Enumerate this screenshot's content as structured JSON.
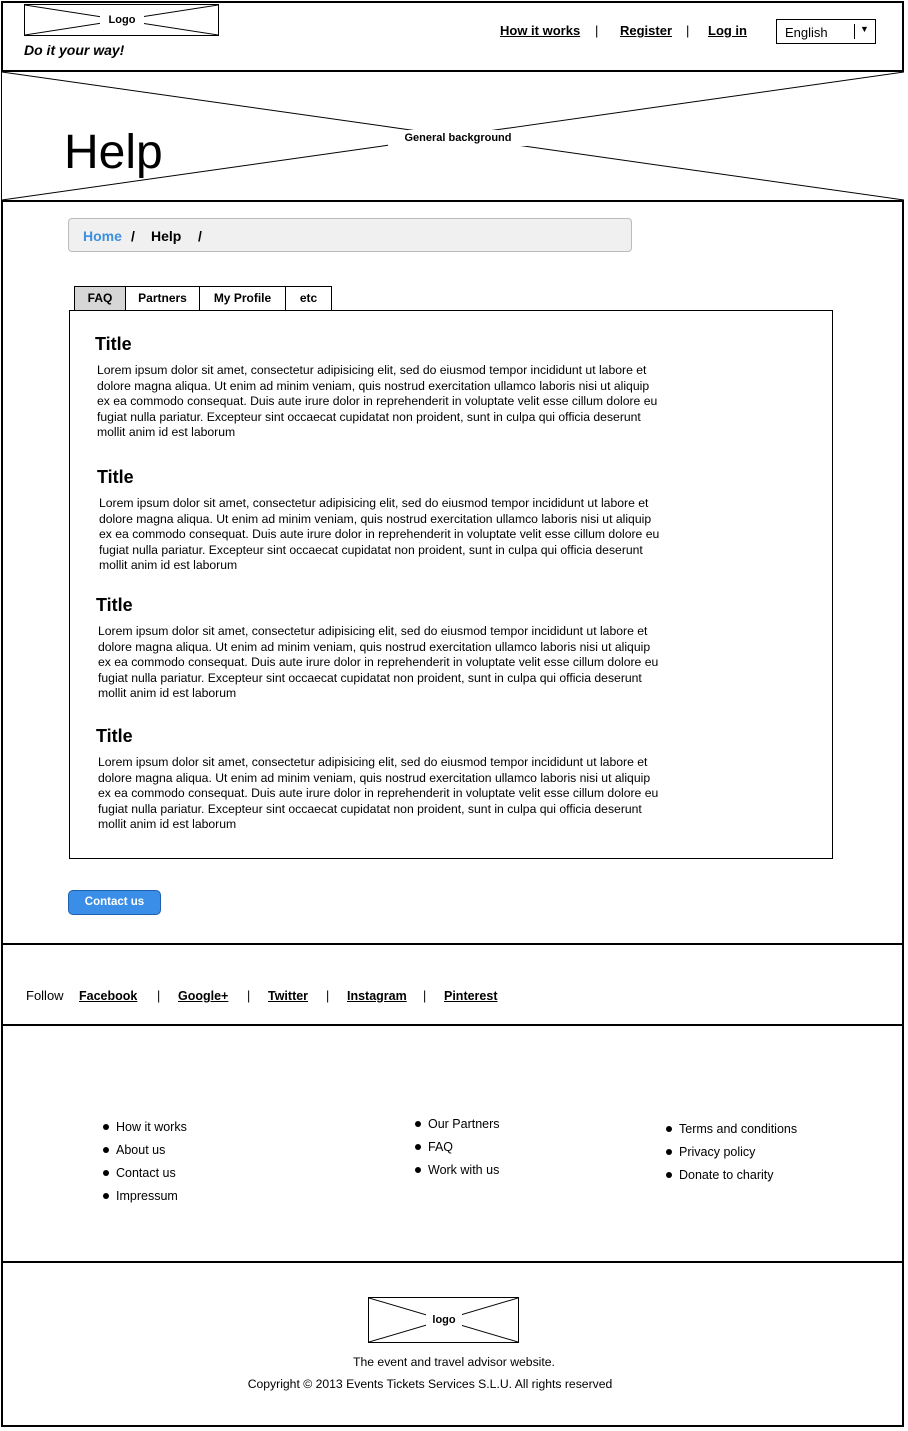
{
  "header": {
    "logo_label": "Logo",
    "tagline": "Do it your way!",
    "nav": {
      "how_it_works": "How it works",
      "register": "Register",
      "login": "Log in",
      "separator": "|"
    },
    "language": {
      "selected": "English",
      "caret": "▼"
    }
  },
  "hero": {
    "title": "Help",
    "background_label": "General background"
  },
  "breadcrumb": {
    "items": [
      "Home",
      "Help"
    ],
    "separator": "/"
  },
  "tabs": [
    "FAQ",
    "Partners",
    "My Profile",
    "etc"
  ],
  "faq": [
    {
      "title": "Title",
      "body": "Lorem ipsum dolor sit amet, consectetur adipisicing elit, sed do eiusmod tempor incididunt ut labore et dolore magna aliqua. Ut enim ad minim veniam, quis nostrud exercitation ullamco laboris nisi ut aliquip ex ea commodo consequat. Duis aute irure dolor in reprehenderit in voluptate velit esse cillum dolore eu fugiat nulla pariatur. Excepteur sint occaecat cupidatat non proident, sunt in culpa qui officia deserunt mollit anim id est laborum"
    },
    {
      "title": "Title",
      "body": "Lorem ipsum dolor sit amet, consectetur adipisicing elit, sed do eiusmod tempor incididunt ut labore et dolore magna aliqua. Ut enim ad minim veniam, quis nostrud exercitation ullamco laboris nisi ut aliquip ex ea commodo consequat. Duis aute irure dolor in reprehenderit in voluptate velit esse cillum dolore eu fugiat nulla pariatur. Excepteur sint occaecat cupidatat non proident, sunt in culpa qui officia deserunt mollit anim id est laborum"
    },
    {
      "title": "Title",
      "body": "Lorem ipsum dolor sit amet, consectetur adipisicing elit, sed do eiusmod tempor incididunt ut labore et dolore magna aliqua. Ut enim ad minim veniam, quis nostrud exercitation ullamco laboris nisi ut aliquip ex ea commodo consequat. Duis aute irure dolor in reprehenderit in voluptate velit esse cillum dolore eu fugiat nulla pariatur. Excepteur sint occaecat cupidatat non proident, sunt in culpa qui officia deserunt mollit anim id est laborum"
    },
    {
      "title": "Title",
      "body": "Lorem ipsum dolor sit amet, consectetur adipisicing elit, sed do eiusmod tempor incididunt ut labore et dolore magna aliqua. Ut enim ad minim veniam, quis nostrud exercitation ullamco laboris nisi ut aliquip ex ea commodo consequat. Duis aute irure dolor in reprehenderit in voluptate velit esse cillum dolore eu fugiat nulla pariatur. Excepteur sint occaecat cupidatat non proident, sunt in culpa qui officia deserunt mollit anim id est laborum"
    }
  ],
  "contact_button": "Contact us",
  "follow": {
    "label": "Follow",
    "links": [
      "Facebook",
      "Google+",
      "Twitter",
      "Instagram",
      "Pinterest"
    ],
    "separator": "|"
  },
  "footer": {
    "col1": [
      "How it works",
      "About us",
      "Contact us",
      "Impressum"
    ],
    "col2": [
      "Our Partners",
      "FAQ",
      "Work with us"
    ],
    "col3": [
      "Terms and conditions",
      "Privacy policy",
      "Donate to charity"
    ],
    "logo_label": "logo",
    "tagline": "The event and travel advisor website.",
    "copyright": "Copyright © 2013 Events Tickets Services S.L.U. All rights reserved"
  },
  "colors": {
    "accent": "#3a8ee8",
    "breadcrumb_link": "#3d8fe0",
    "active_tab": "#d6d6d6"
  }
}
